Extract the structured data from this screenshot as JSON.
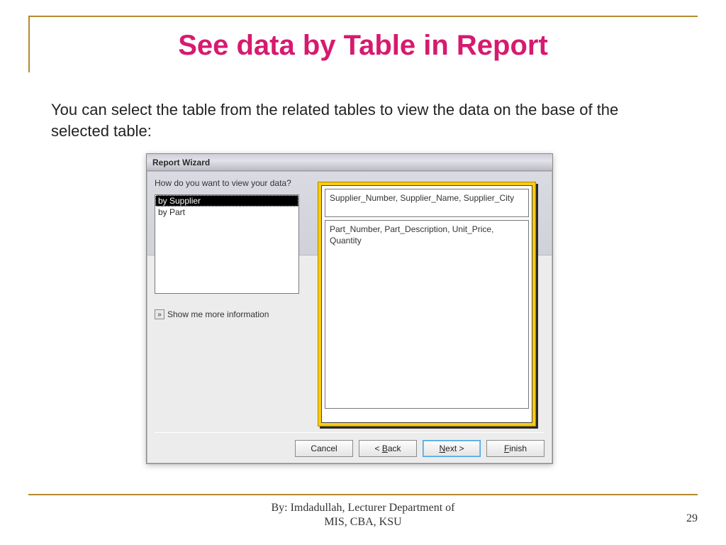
{
  "slide": {
    "title": "See data by Table in Report",
    "description": "You can select the table from the related tables to view the data on the base of the selected table:"
  },
  "wizard": {
    "title": "Report Wizard",
    "question": "How do you want to view your data?",
    "view_options": [
      {
        "label": "by Supplier",
        "selected": true
      },
      {
        "label": "by Part",
        "selected": false
      }
    ],
    "show_more_label": "Show me more information",
    "preview": {
      "header_fields": "Supplier_Number, Supplier_Name, Supplier_City",
      "detail_fields": "Part_Number, Part_Description, Unit_Price, Quantity"
    },
    "buttons": {
      "cancel": "Cancel",
      "back": "Back",
      "next": "Next",
      "finish": "Finish"
    }
  },
  "footer": {
    "line1": "By: Imdadullah, Lecturer Department of",
    "line2": "MIS, CBA, KSU",
    "page": "29"
  }
}
